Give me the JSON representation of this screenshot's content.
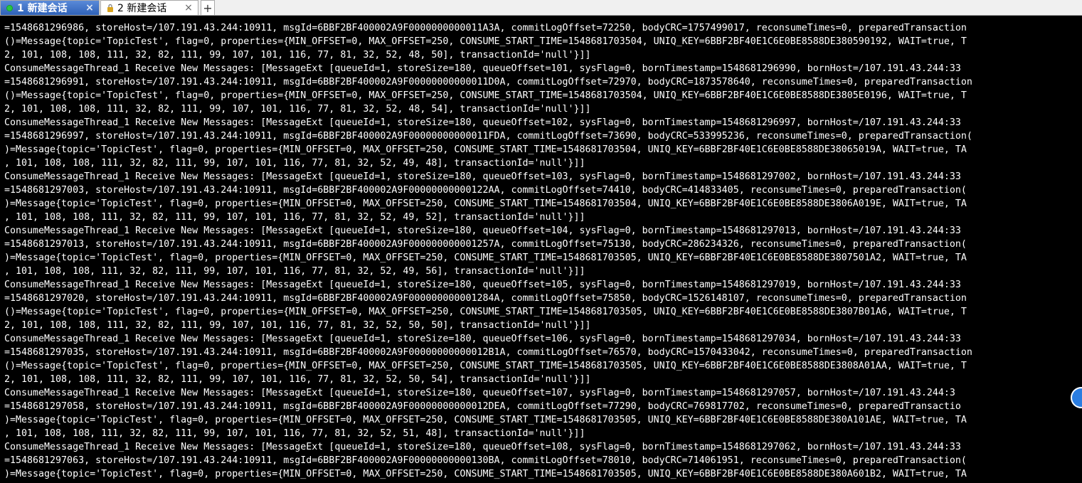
{
  "tabs": [
    {
      "label": "1 新建会话",
      "close": "×",
      "active": true
    },
    {
      "label": "2 新建会话",
      "close": "×",
      "active": false
    }
  ],
  "new_tab_label": "+",
  "terminal_lines": [
    "=1548681296986, storeHost=/107.191.43.244:10911, msgId=6BBF2BF400002A9F0000000000011A3A, commitLogOffset=72250, bodyCRC=1757499017, reconsumeTimes=0, preparedTransaction",
    "()=Message{topic='TopicTest', flag=0, properties={MIN_OFFSET=0, MAX_OFFSET=250, CONSUME_START_TIME=1548681703504, UNIQ_KEY=6BBF2BF40E1C6E0BE8588DE380590192, WAIT=true, T",
    "2, 101, 108, 108, 111, 32, 82, 111, 99, 107, 101, 116, 77, 81, 32, 52, 48, 50], transactionId='null'}]]",
    "ConsumeMessageThread_1 Receive New Messages: [MessageExt [queueId=1, storeSize=180, queueOffset=101, sysFlag=0, bornTimestamp=1548681296990, bornHost=/107.191.43.244:33",
    "=1548681296991, storeHost=/107.191.43.244:10911, msgId=6BBF2BF400002A9F00000000000011D0A, commitLogOffset=72970, bodyCRC=1873578640, reconsumeTimes=0, preparedTransaction",
    "()=Message{topic='TopicTest', flag=0, properties={MIN_OFFSET=0, MAX_OFFSET=250, CONSUME_START_TIME=1548681703504, UNIQ_KEY=6BBF2BF40E1C6E0BE8588DE3805E0196, WAIT=true, T",
    "2, 101, 108, 108, 111, 32, 82, 111, 99, 107, 101, 116, 77, 81, 32, 52, 48, 54], transactionId='null'}]]",
    "ConsumeMessageThread_1 Receive New Messages: [MessageExt [queueId=1, storeSize=180, queueOffset=102, sysFlag=0, bornTimestamp=1548681296997, bornHost=/107.191.43.244:33",
    "=1548681296997, storeHost=/107.191.43.244:10911, msgId=6BBF2BF400002A9F00000000000011FDA, commitLogOffset=73690, bodyCRC=533995236, reconsumeTimes=0, preparedTransaction(",
    ")=Message{topic='TopicTest', flag=0, properties={MIN_OFFSET=0, MAX_OFFSET=250, CONSUME_START_TIME=1548681703504, UNIQ_KEY=6BBF2BF40E1C6E0BE8588DE38065019A, WAIT=true, TA",
    ", 101, 108, 108, 111, 32, 82, 111, 99, 107, 101, 116, 77, 81, 32, 52, 49, 48], transactionId='null'}]]",
    "ConsumeMessageThread_1 Receive New Messages: [MessageExt [queueId=1, storeSize=180, queueOffset=103, sysFlag=0, bornTimestamp=1548681297002, bornHost=/107.191.43.244:33",
    "=1548681297003, storeHost=/107.191.43.244:10911, msgId=6BBF2BF400002A9F00000000000122AA, commitLogOffset=74410, bodyCRC=414833405, reconsumeTimes=0, preparedTransaction(",
    ")=Message{topic='TopicTest', flag=0, properties={MIN_OFFSET=0, MAX_OFFSET=250, CONSUME_START_TIME=1548681703504, UNIQ_KEY=6BBF2BF40E1C6E0BE8588DE3806A019E, WAIT=true, TA",
    ", 101, 108, 108, 111, 32, 82, 111, 99, 107, 101, 116, 77, 81, 32, 52, 49, 52], transactionId='null'}]]",
    "ConsumeMessageThread_1 Receive New Messages: [MessageExt [queueId=1, storeSize=180, queueOffset=104, sysFlag=0, bornTimestamp=1548681297013, bornHost=/107.191.43.244:33",
    "=1548681297013, storeHost=/107.191.43.244:10911, msgId=6BBF2BF400002A9F000000000001257A, commitLogOffset=75130, bodyCRC=286234326, reconsumeTimes=0, preparedTransaction(",
    ")=Message{topic='TopicTest', flag=0, properties={MIN_OFFSET=0, MAX_OFFSET=250, CONSUME_START_TIME=1548681703505, UNIQ_KEY=6BBF2BF40E1C6E0BE8588DE3807501A2, WAIT=true, TA",
    ", 101, 108, 108, 111, 32, 82, 111, 99, 107, 101, 116, 77, 81, 32, 52, 49, 56], transactionId='null'}]]",
    "ConsumeMessageThread_1 Receive New Messages: [MessageExt [queueId=1, storeSize=180, queueOffset=105, sysFlag=0, bornTimestamp=1548681297019, bornHost=/107.191.43.244:33",
    "=1548681297020, storeHost=/107.191.43.244:10911, msgId=6BBF2BF400002A9F000000000001284A, commitLogOffset=75850, bodyCRC=1526148107, reconsumeTimes=0, preparedTransaction",
    "()=Message{topic='TopicTest', flag=0, properties={MIN_OFFSET=0, MAX_OFFSET=250, CONSUME_START_TIME=1548681703505, UNIQ_KEY=6BBF2BF40E1C6E0BE8588DE3807B01A6, WAIT=true, T",
    "2, 101, 108, 108, 111, 32, 82, 111, 99, 107, 101, 116, 77, 81, 32, 52, 50, 50], transactionId='null'}]]",
    "ConsumeMessageThread_1 Receive New Messages: [MessageExt [queueId=1, storeSize=180, queueOffset=106, sysFlag=0, bornTimestamp=1548681297034, bornHost=/107.191.43.244:33",
    "=1548681297035, storeHost=/107.191.43.244:10911, msgId=6BBF2BF400002A9F00000000000012B1A, commitLogOffset=76570, bodyCRC=1570433042, reconsumeTimes=0, preparedTransaction",
    "()=Message{topic='TopicTest', flag=0, properties={MIN_OFFSET=0, MAX_OFFSET=250, CONSUME_START_TIME=1548681703505, UNIQ_KEY=6BBF2BF40E1C6E0BE8588DE3808A01AA, WAIT=true, T",
    "2, 101, 108, 108, 111, 32, 82, 111, 99, 107, 101, 116, 77, 81, 32, 52, 50, 54], transactionId='null'}]]",
    "ConsumeMessageThread_1 Receive New Messages: [MessageExt [queueId=1, storeSize=180, queueOffset=107, sysFlag=0, bornTimestamp=1548681297057, bornHost=/107.191.43.244:3",
    "=1548681297058, storeHost=/107.191.43.244:10911, msgId=6BBF2BF400002A9F00000000000012DEA, commitLogOffset=77290, bodyCRC=769817702, reconsumeTimes=0, preparedTransactio",
    ")=Message{topic='TopicTest', flag=0, properties={MIN_OFFSET=0, MAX_OFFSET=250, CONSUME_START_TIME=1548681703505, UNIQ_KEY=6BBF2BF40E1C6E0BE8588DE380A101AE, WAIT=true, TA",
    ", 101, 108, 108, 111, 32, 82, 111, 99, 107, 101, 116, 77, 81, 32, 52, 51, 48], transactionId='null'}]]",
    "ConsumeMessageThread_1 Receive New Messages: [MessageExt [queueId=1, storeSize=180, queueOffset=108, sysFlag=0, bornTimestamp=1548681297062, bornHost=/107.191.43.244:33",
    "=1548681297063, storeHost=/107.191.43.244:10911, msgId=6BBF2BF400002A9F00000000000130BA, commitLogOffset=78010, bodyCRC=714061951, reconsumeTimes=0, preparedTransaction(",
    ")=Message{topic='TopicTest', flag=0, properties={MIN_OFFSET=0, MAX_OFFSET=250, CONSUME_START_TIME=1548681703505, UNIQ_KEY=6BBF2BF40E1C6E0BE8588DE380A601B2, WAIT=true, TA"
  ]
}
